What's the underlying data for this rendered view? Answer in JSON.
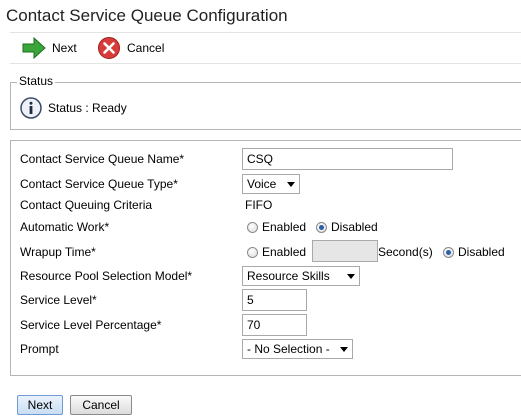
{
  "page": {
    "title": "Contact Service Queue Configuration"
  },
  "toolbar": {
    "next_label": "Next",
    "cancel_label": "Cancel"
  },
  "status": {
    "legend": "Status",
    "text": "Status : Ready"
  },
  "form": {
    "csq_name": {
      "label": "Contact Service Queue Name*",
      "value": "CSQ"
    },
    "csq_type": {
      "label": "Contact Service Queue Type*",
      "value": "Voice"
    },
    "queuing_criteria": {
      "label": "Contact Queuing Criteria",
      "value": "FIFO"
    },
    "automatic_work": {
      "label": "Automatic Work*",
      "option_enabled": "Enabled",
      "option_disabled": "Disabled",
      "selected": "Disabled"
    },
    "wrapup_time": {
      "label": "Wrapup Time*",
      "option_enabled": "Enabled",
      "seconds_value": "",
      "seconds_label": "Second(s)",
      "option_disabled": "Disabled",
      "selected": "Disabled"
    },
    "pool_model": {
      "label": "Resource Pool Selection Model*",
      "value": "Resource Skills"
    },
    "service_level": {
      "label": "Service Level*",
      "value": "5"
    },
    "service_level_pct": {
      "label": "Service Level Percentage*",
      "value": "70"
    },
    "prompt": {
      "label": "Prompt",
      "value": "- No Selection -"
    }
  },
  "footer": {
    "next_label": "Next",
    "cancel_label": "Cancel"
  }
}
